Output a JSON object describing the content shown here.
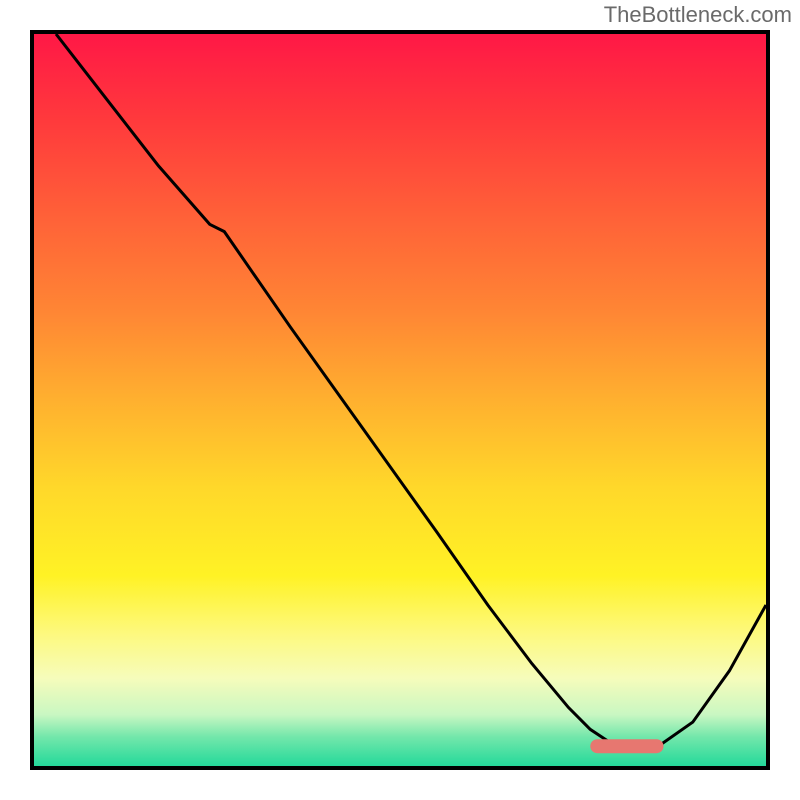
{
  "watermark": "TheBottleneck.com",
  "chart_data": {
    "type": "line",
    "title": "",
    "xlabel": "",
    "ylabel": "",
    "xlim": [
      0,
      100
    ],
    "ylim": [
      0,
      100
    ],
    "gradient_stops": [
      {
        "offset": 0,
        "color": "#ff1846"
      },
      {
        "offset": 12,
        "color": "#ff3a3c"
      },
      {
        "offset": 25,
        "color": "#ff6138"
      },
      {
        "offset": 38,
        "color": "#ff8634"
      },
      {
        "offset": 50,
        "color": "#ffb02f"
      },
      {
        "offset": 62,
        "color": "#ffd82a"
      },
      {
        "offset": 74,
        "color": "#fff225"
      },
      {
        "offset": 82,
        "color": "#fdf97f"
      },
      {
        "offset": 88,
        "color": "#f6fcbb"
      },
      {
        "offset": 93,
        "color": "#c9f7c2"
      },
      {
        "offset": 96,
        "color": "#73e7ab"
      },
      {
        "offset": 100,
        "color": "#24d99a"
      }
    ],
    "series": [
      {
        "name": "curve",
        "color": "#000000",
        "x": [
          3,
          10,
          17,
          24,
          26,
          35,
          45,
          55,
          62,
          68,
          73,
          76,
          79,
          82,
          85,
          90,
          95,
          100
        ],
        "y": [
          100,
          91,
          82,
          74,
          73,
          60,
          46,
          32,
          22,
          14,
          8,
          5,
          3,
          2.5,
          2.5,
          6,
          13,
          22
        ]
      }
    ],
    "markers": [
      {
        "name": "optimal-zone",
        "type": "rounded-bar",
        "x_start": 76,
        "x_end": 86,
        "y": 2.7,
        "color": "#e77770"
      }
    ]
  }
}
